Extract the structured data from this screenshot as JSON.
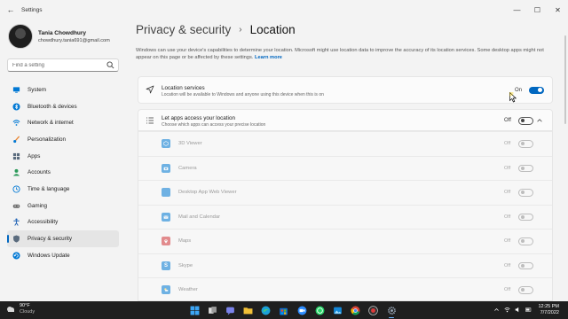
{
  "window": {
    "title": "Settings",
    "back_glyph": "←",
    "controls": [
      "—",
      "☐",
      "✕"
    ]
  },
  "profile": {
    "name": "Tania Chowdhury",
    "email": "chowdhury.tania691@gmail.com"
  },
  "search": {
    "placeholder": "Find a setting"
  },
  "nav": {
    "items": [
      {
        "label": "System",
        "icon": "monitor-icon"
      },
      {
        "label": "Bluetooth & devices",
        "icon": "bluetooth-icon"
      },
      {
        "label": "Network & internet",
        "icon": "network-icon"
      },
      {
        "label": "Personalization",
        "icon": "brush-icon"
      },
      {
        "label": "Apps",
        "icon": "apps-icon"
      },
      {
        "label": "Accounts",
        "icon": "person-icon"
      },
      {
        "label": "Time & language",
        "icon": "globe-clock-icon"
      },
      {
        "label": "Gaming",
        "icon": "gamepad-icon"
      },
      {
        "label": "Accessibility",
        "icon": "accessibility-icon"
      },
      {
        "label": "Privacy & security",
        "icon": "shield-icon",
        "active": true
      },
      {
        "label": "Windows Update",
        "icon": "update-icon"
      }
    ]
  },
  "page": {
    "breadcrumb_parent": "Privacy & security",
    "separator": "›",
    "title": "Location",
    "description": "Windows can use your device's capabilities to determine your location. Microsoft might use location data to improve the accuracy of its location services. Some desktop apps might not appear on this page or be affected by these settings.",
    "learn_more": "Learn more"
  },
  "location_services": {
    "title": "Location services",
    "subtitle": "Location will be available to Windows and anyone using this device when this is on",
    "state": "On",
    "on": true
  },
  "let_apps": {
    "title": "Let apps access your location",
    "subtitle": "Choose which apps can access your precise location",
    "state": "Off",
    "on": false,
    "expanded": true
  },
  "apps": [
    {
      "name": "3D Viewer",
      "state": "Off",
      "color": "#0078d4"
    },
    {
      "name": "Camera",
      "state": "Off",
      "color": "#0078d4"
    },
    {
      "name": "Desktop App Web Viewer",
      "state": "Off",
      "color": "#0078d4"
    },
    {
      "name": "Mail and Calendar",
      "state": "Off",
      "color": "#0078d4"
    },
    {
      "name": "Maps",
      "state": "Off",
      "color": "#d13438"
    },
    {
      "name": "Skype",
      "state": "Off",
      "color": "#0078d4"
    },
    {
      "name": "Weather",
      "state": "Off",
      "color": "#0078d4"
    }
  ],
  "taskbar": {
    "weather_temp": "90°F",
    "weather_desc": "Cloudy",
    "time": "12:25 PM",
    "date": "7/7/2022"
  },
  "colors": {
    "accent": "#0067c0",
    "background": "#f3f3f3",
    "taskbar": "#1f1f1f"
  }
}
